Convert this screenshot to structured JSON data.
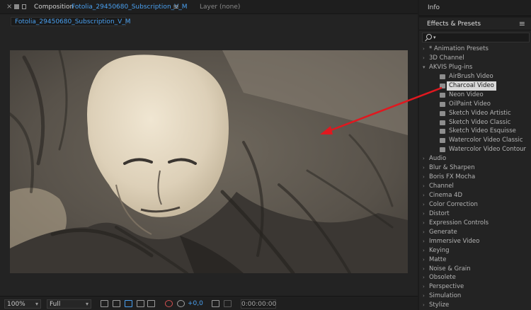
{
  "composition_panel": {
    "header_label": "Composition",
    "composition_name": "Fotolia_29450680_Subscription_V_M",
    "layer_label": "Layer (none)",
    "tab_label": "Fotolia_29450680_Subscription_V_M",
    "close_icon": "close-icon",
    "panel_menu_icon": "hamburger-menu-icon"
  },
  "footer": {
    "zoom": "100%",
    "resolution": "Full",
    "exposure": "+0,0",
    "timecode": "0:00:00:00"
  },
  "info_panel": {
    "title": "Info"
  },
  "effects_panel": {
    "title": "Effects & Presets",
    "menu_icon": "hamburger-menu-icon",
    "search_placeholder": "",
    "items": [
      {
        "label": "* Animation Presets",
        "state": "collapsed"
      },
      {
        "label": "3D Channel",
        "state": "collapsed"
      },
      {
        "label": "AKVIS Plug-ins",
        "state": "expanded"
      },
      {
        "label": "AirBrush Video",
        "state": "child"
      },
      {
        "label": "Charcoal Video",
        "state": "child-selected"
      },
      {
        "label": "Neon Video",
        "state": "child"
      },
      {
        "label": "OilPaint Video",
        "state": "child"
      },
      {
        "label": "Sketch Video Artistic",
        "state": "child"
      },
      {
        "label": "Sketch Video Classic",
        "state": "child"
      },
      {
        "label": "Sketch Video Esquisse",
        "state": "child"
      },
      {
        "label": "Watercolor Video Classic",
        "state": "child"
      },
      {
        "label": "Watercolor Video Contour",
        "state": "child"
      },
      {
        "label": "Audio",
        "state": "collapsed"
      },
      {
        "label": "Blur & Sharpen",
        "state": "collapsed"
      },
      {
        "label": "Boris FX Mocha",
        "state": "collapsed"
      },
      {
        "label": "Channel",
        "state": "collapsed"
      },
      {
        "label": "Cinema 4D",
        "state": "collapsed"
      },
      {
        "label": "Color Correction",
        "state": "collapsed"
      },
      {
        "label": "Distort",
        "state": "collapsed"
      },
      {
        "label": "Expression Controls",
        "state": "collapsed"
      },
      {
        "label": "Generate",
        "state": "collapsed"
      },
      {
        "label": "Immersive Video",
        "state": "collapsed"
      },
      {
        "label": "Keying",
        "state": "collapsed"
      },
      {
        "label": "Matte",
        "state": "collapsed"
      },
      {
        "label": "Noise & Grain",
        "state": "collapsed"
      },
      {
        "label": "Obsolete",
        "state": "collapsed"
      },
      {
        "label": "Perspective",
        "state": "collapsed"
      },
      {
        "label": "Simulation",
        "state": "collapsed"
      },
      {
        "label": "Stylize",
        "state": "collapsed"
      }
    ]
  },
  "colors": {
    "accent_blue": "#4aa0f0",
    "annotation_arrow": "#e0181f",
    "selection_bg": "#d9d9d9"
  }
}
